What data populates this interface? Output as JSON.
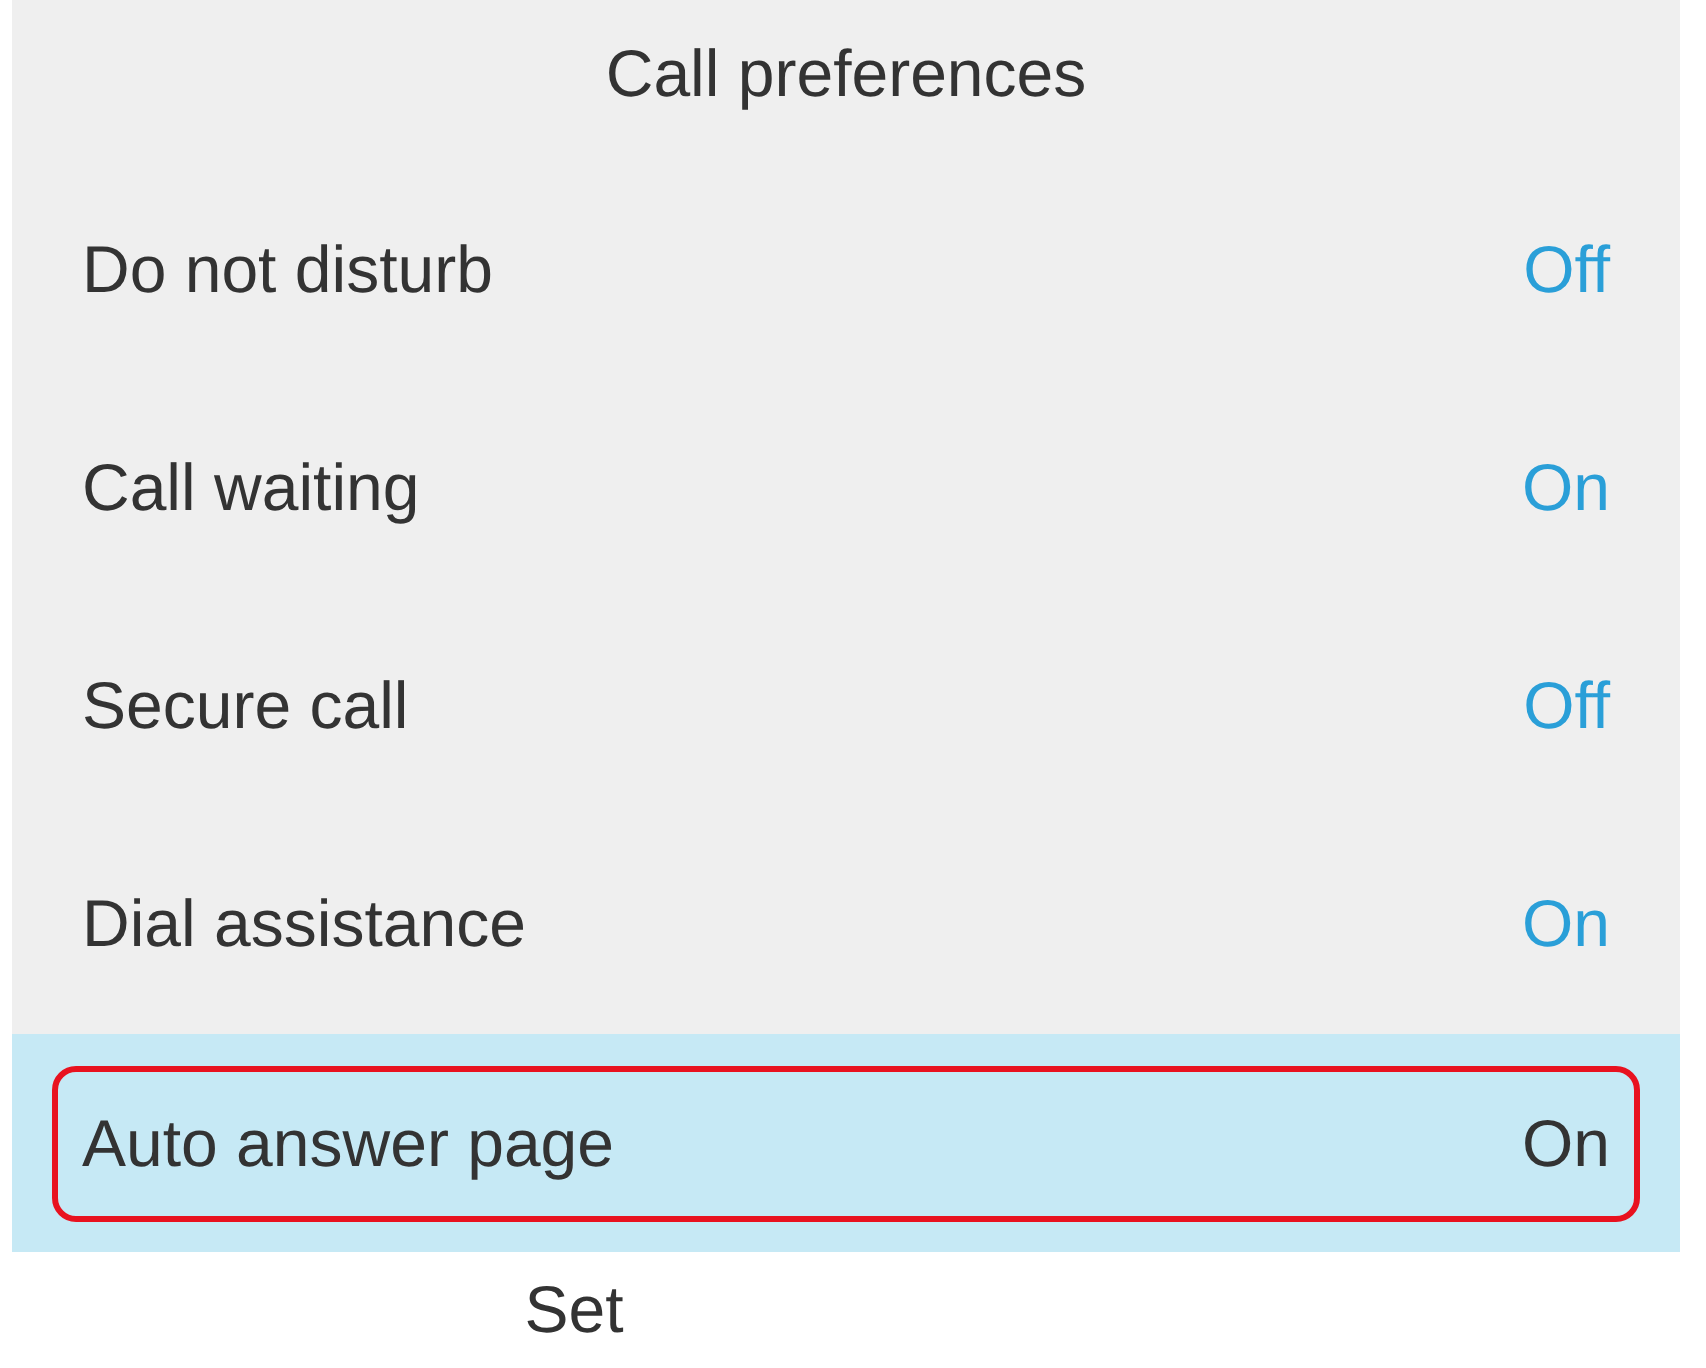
{
  "title": "Call preferences",
  "rows": [
    {
      "label": "Do not disturb",
      "value": "Off",
      "selected": false
    },
    {
      "label": "Call waiting",
      "value": "On",
      "selected": false
    },
    {
      "label": "Secure call",
      "value": "Off",
      "selected": false
    },
    {
      "label": "Dial assistance",
      "value": "On",
      "selected": false
    },
    {
      "label": "Auto answer page",
      "value": "On",
      "selected": true
    }
  ],
  "softkeys": [
    "Set"
  ]
}
